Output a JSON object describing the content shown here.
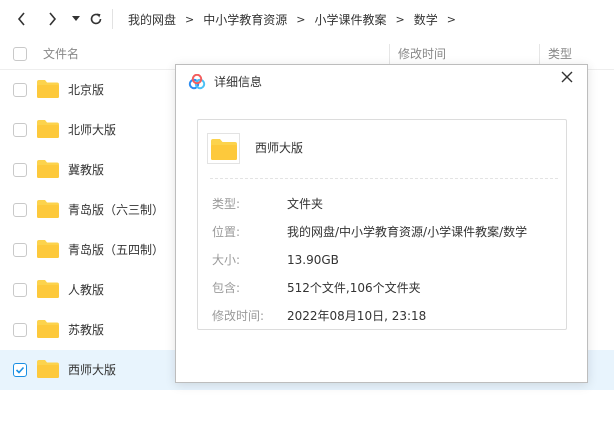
{
  "toolbar": {
    "back_icon": "chevron-left-icon",
    "forward_icon": "chevron-right-icon",
    "history_icon": "caret-down-icon",
    "refresh_icon": "refresh-icon"
  },
  "breadcrumb": {
    "items": [
      "我的网盘",
      "中小学教育资源",
      "小学课件教案",
      "数学"
    ],
    "separator": ">"
  },
  "columns": {
    "name": "文件名",
    "modified": "修改时间",
    "type": "类型"
  },
  "files": [
    {
      "name": "北京版",
      "selected": false
    },
    {
      "name": "北师大版",
      "selected": false
    },
    {
      "name": "冀教版",
      "selected": false
    },
    {
      "name": "青岛版（六三制）",
      "selected": false
    },
    {
      "name": "青岛版（五四制）",
      "selected": false
    },
    {
      "name": "人教版",
      "selected": false
    },
    {
      "name": "苏教版",
      "selected": false
    },
    {
      "name": "西师大版",
      "selected": true
    }
  ],
  "dialog": {
    "title": "详细信息",
    "logo_icon": "cloud-logo-icon",
    "close_icon": "close-icon",
    "item_name": "西师大版",
    "rows": [
      {
        "key": "类型:",
        "value": "文件夹"
      },
      {
        "key": "位置:",
        "value": "我的网盘/中小学教育资源/小学课件教案/数学"
      },
      {
        "key": "大小:",
        "value": "13.90GB"
      },
      {
        "key": "包含:",
        "value": "512个文件,106个文件夹"
      },
      {
        "key": "修改时间:",
        "value": "2022年08月10日, 23:18"
      }
    ]
  },
  "colors": {
    "folder": "#fcd34d",
    "selected_row": "#e8f4fd",
    "check": "#1a8fe3"
  }
}
